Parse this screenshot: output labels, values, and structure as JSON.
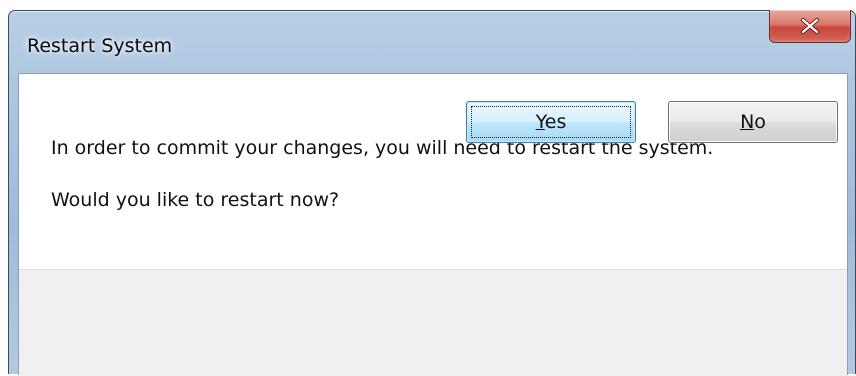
{
  "window": {
    "title": "Restart System",
    "close_icon": "close-x-icon"
  },
  "message": {
    "line1": "In order to commit your changes, you will need to restart the system.",
    "line2": "Would you like to restart now?"
  },
  "buttons": {
    "yes": {
      "mnemonic": "Y",
      "rest": "es"
    },
    "no": {
      "mnemonic": "N",
      "rest": "o"
    }
  },
  "colors": {
    "close_button": "#c8453a",
    "default_button_border": "#3c7fb1"
  }
}
